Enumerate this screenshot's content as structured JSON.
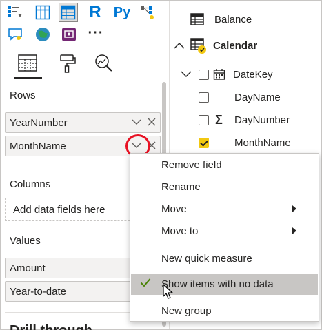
{
  "visual_gallery": {
    "icons": [
      "stacked-bar-chart-icon",
      "table-icon",
      "matrix-icon",
      "r-script-icon",
      "python-visual-icon",
      "decomposition-tree-icon",
      "qa-visual-icon",
      "arcgis-map-icon",
      "power-apps-icon",
      "more-visuals-icon"
    ],
    "r_label": "R",
    "py_label": "Py",
    "more_label": "···"
  },
  "pane_tabs": [
    "fields-tab",
    "format-tab",
    "analytics-tab"
  ],
  "wells": {
    "rows_label": "Rows",
    "rows_fields": [
      "YearNumber",
      "MonthName"
    ],
    "columns_label": "Columns",
    "columns_placeholder": "Add data fields here",
    "values_label": "Values",
    "values_fields": [
      "Amount",
      "Year-to-date"
    ],
    "drillthrough_label": "Drill through"
  },
  "fields_tree": {
    "tables": [
      {
        "name": "Balance",
        "expanded": false
      },
      {
        "name": "Calendar",
        "expanded": true
      }
    ],
    "calendar_fields": [
      {
        "name": "DateKey",
        "icon": "calendar-icon",
        "checked": false
      },
      {
        "name": "DayName",
        "icon": "",
        "checked": false
      },
      {
        "name": "DayNumber",
        "icon": "sigma-icon",
        "checked": false
      },
      {
        "name": "MonthName",
        "icon": "",
        "checked": true
      }
    ]
  },
  "context_menu": {
    "items": [
      {
        "label": "Remove field"
      },
      {
        "label": "Rename"
      },
      {
        "label": "Move",
        "submenu": true
      },
      {
        "label": "Move to",
        "submenu": true
      },
      {
        "label": "New quick measure"
      },
      {
        "label": "Show items with no data",
        "checked": true,
        "hovered": true
      },
      {
        "label": "New group"
      }
    ]
  },
  "colors": {
    "accent_yellow": "#f2c811",
    "highlight_red": "#e81123",
    "check_green": "#498205",
    "hover_gray": "#c8c6c4"
  }
}
